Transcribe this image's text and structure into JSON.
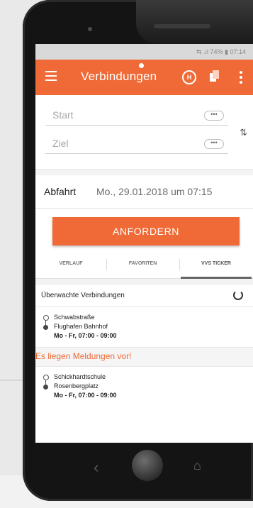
{
  "statusbar": {
    "text": "⇆ .ıl 74% ▮ 07:14"
  },
  "appbar": {
    "title": "Verbindungen",
    "h_icon_label": "H",
    "icons": [
      "menu-icon",
      "h-circle-icon",
      "copy-icon",
      "more-vert-icon"
    ]
  },
  "form": {
    "start_placeholder": "Start",
    "ziel_placeholder": "Ziel",
    "dots": "•••",
    "swap_icon": "⇅"
  },
  "abfahrt": {
    "label": "Abfahrt",
    "value": "Mo., 29.01.2018 um 07:15"
  },
  "actions": {
    "anfordern_label": "ANFORDERN"
  },
  "tabs": [
    {
      "label": "VERLAUF"
    },
    {
      "label": "FAVORITEN"
    },
    {
      "label": "VVS TICKER",
      "active": true
    }
  ],
  "monitored": {
    "title": "Überwachte Verbindungen",
    "connections": [
      {
        "from": "Schwabstraße",
        "to": "Flughafen Bahnhof",
        "time": "Mo - Fr, 07:00 - 09:00"
      },
      {
        "from": "Schickhardtschule",
        "to": "Rosenbergplatz",
        "time": "Mo - Fr, 07:00 - 09:00"
      }
    ],
    "message": "Es liegen Meldungen vor!"
  },
  "navbar": {
    "back_glyph": "‹",
    "home_glyph": "⌂"
  },
  "colors": {
    "accent": "#ef6a36",
    "status_bg": "#d9d9d9"
  }
}
